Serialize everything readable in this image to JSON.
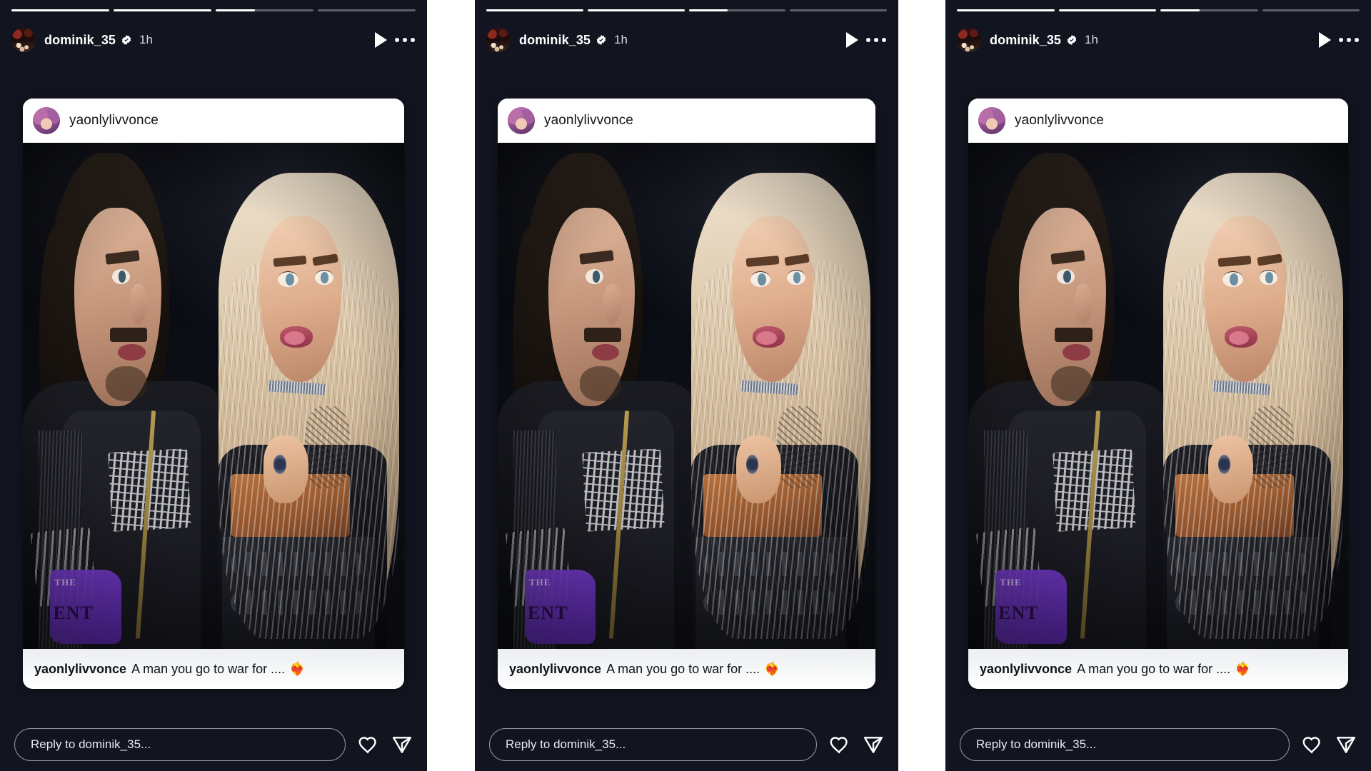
{
  "app": {
    "name": "Instagram Stories",
    "background_color": "#121520",
    "panel_background": "#121520",
    "gap_color": "#ffffff",
    "accent_verified_color": "#ffffff"
  },
  "story": {
    "progress": {
      "segment_count": 4,
      "fills_percent": [
        100,
        100,
        40,
        0
      ]
    },
    "author": {
      "username": "dominik_35",
      "verified": true,
      "verified_icon": "verified-badge-icon",
      "timestamp": "1h",
      "avatar_alt": "dominik_35-avatar"
    },
    "header_actions": [
      {
        "name": "play-button",
        "icon": "play-icon"
      },
      {
        "name": "more-options-button",
        "icon": "more-horizontal-icon"
      }
    ]
  },
  "post": {
    "author": {
      "username": "yaonlylivvonce",
      "avatar_alt": "yaonlylivvonce-avatar"
    },
    "photo": {
      "alt": "Two wrestlers standing close together under arena lighting",
      "shirt_graphic_line1": "THE",
      "shirt_graphic_line2": "ENT"
    },
    "caption": {
      "username": "yaonlylivvonce",
      "text": "A man you go to war for ....",
      "emoji": "❤️‍🔥"
    }
  },
  "reply": {
    "placeholder": "Reply to dominik_35...",
    "value": "",
    "actions": [
      {
        "name": "like-button",
        "icon": "heart-icon"
      },
      {
        "name": "share-button",
        "icon": "send-icon"
      }
    ]
  },
  "panels": [
    {
      "id": "panel-1",
      "label": "story-view-panel-1"
    },
    {
      "id": "panel-2",
      "label": "story-view-panel-2"
    },
    {
      "id": "panel-3",
      "label": "story-view-panel-3"
    }
  ]
}
